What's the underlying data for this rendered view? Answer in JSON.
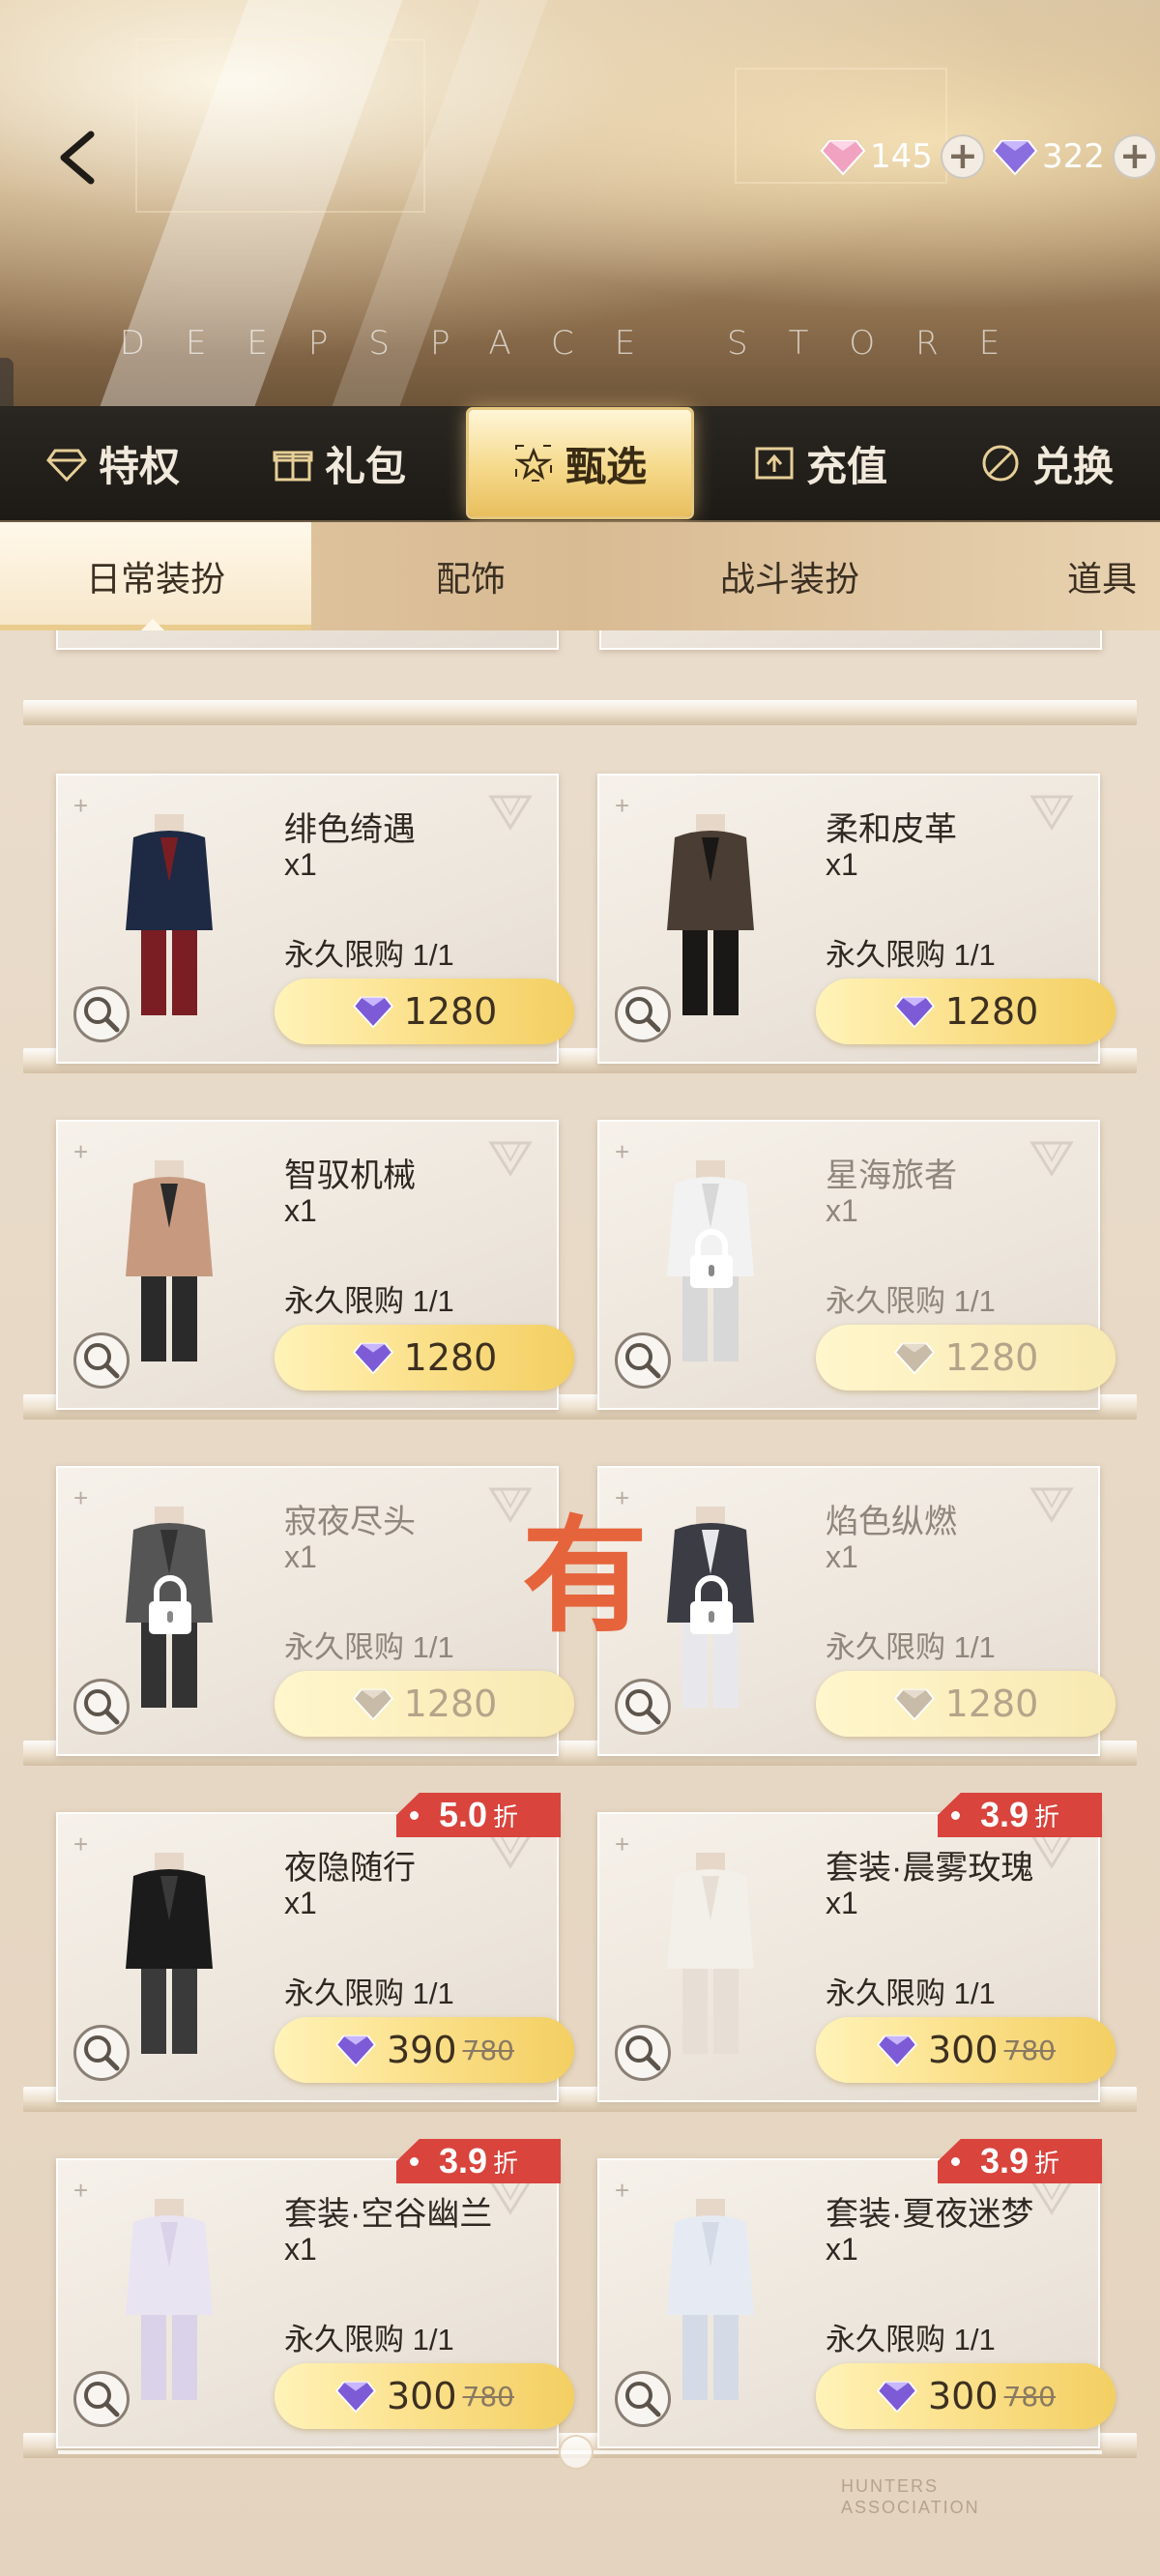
{
  "header": {
    "store_title": "DEEPSPACE STORE",
    "currency_pink": "145",
    "currency_purple": "322"
  },
  "main_tabs": [
    {
      "label": "特权",
      "icon": "diamond-icon"
    },
    {
      "label": "礼包",
      "icon": "gift-icon"
    },
    {
      "label": "甄选",
      "icon": "star-frame-icon",
      "active": true
    },
    {
      "label": "充值",
      "icon": "upload-box-icon"
    },
    {
      "label": "兑换",
      "icon": "exchange-icon"
    }
  ],
  "sub_tabs": [
    {
      "label": "日常装扮",
      "active": true
    },
    {
      "label": "配饰"
    },
    {
      "label": "战斗装扮"
    },
    {
      "label": "道具"
    }
  ],
  "products": [
    {
      "name": "绯色绮遇",
      "qty": "x1",
      "limit": "永久限购 1/1",
      "price": "1280",
      "locked": false
    },
    {
      "name": "柔和皮革",
      "qty": "x1",
      "limit": "永久限购 1/1",
      "price": "1280",
      "locked": false
    },
    {
      "name": "智驭机械",
      "qty": "x1",
      "limit": "永久限购 1/1",
      "price": "1280",
      "locked": false
    },
    {
      "name": "星海旅者",
      "qty": "x1",
      "limit": "永久限购 1/1",
      "price": "1280",
      "locked": true
    },
    {
      "name": "寂夜尽头",
      "qty": "x1",
      "limit": "永久限购 1/1",
      "price": "1280",
      "locked": true
    },
    {
      "name": "焰色纵燃",
      "qty": "x1",
      "limit": "永久限购 1/1",
      "price": "1280",
      "locked": true
    },
    {
      "name": "夜隐随行",
      "qty": "x1",
      "limit": "永久限购 1/1",
      "price": "390",
      "old_price": "780",
      "discount": "5.0",
      "discount_unit": "折",
      "locked": false
    },
    {
      "name": "套装·晨雾玫瑰",
      "qty": "x1",
      "limit": "永久限购 1/1",
      "price": "300",
      "old_price": "780",
      "discount": "3.9",
      "discount_unit": "折",
      "locked": false
    },
    {
      "name": "套装·空谷幽兰",
      "qty": "x1",
      "limit": "永久限购 1/1",
      "price": "300",
      "old_price": "780",
      "discount": "3.9",
      "discount_unit": "折",
      "locked": false
    },
    {
      "name": "套装·夏夜迷梦",
      "qty": "x1",
      "limit": "永久限购 1/1",
      "price": "300",
      "old_price": "780",
      "discount": "3.9",
      "discount_unit": "折",
      "locked": false
    }
  ],
  "watermark": "有",
  "colors": {
    "accent_gold": "#f5d98a",
    "nav_dark": "#1d1a16",
    "discount_red": "#d9443d",
    "gem_purple": "#7d5bd6"
  }
}
